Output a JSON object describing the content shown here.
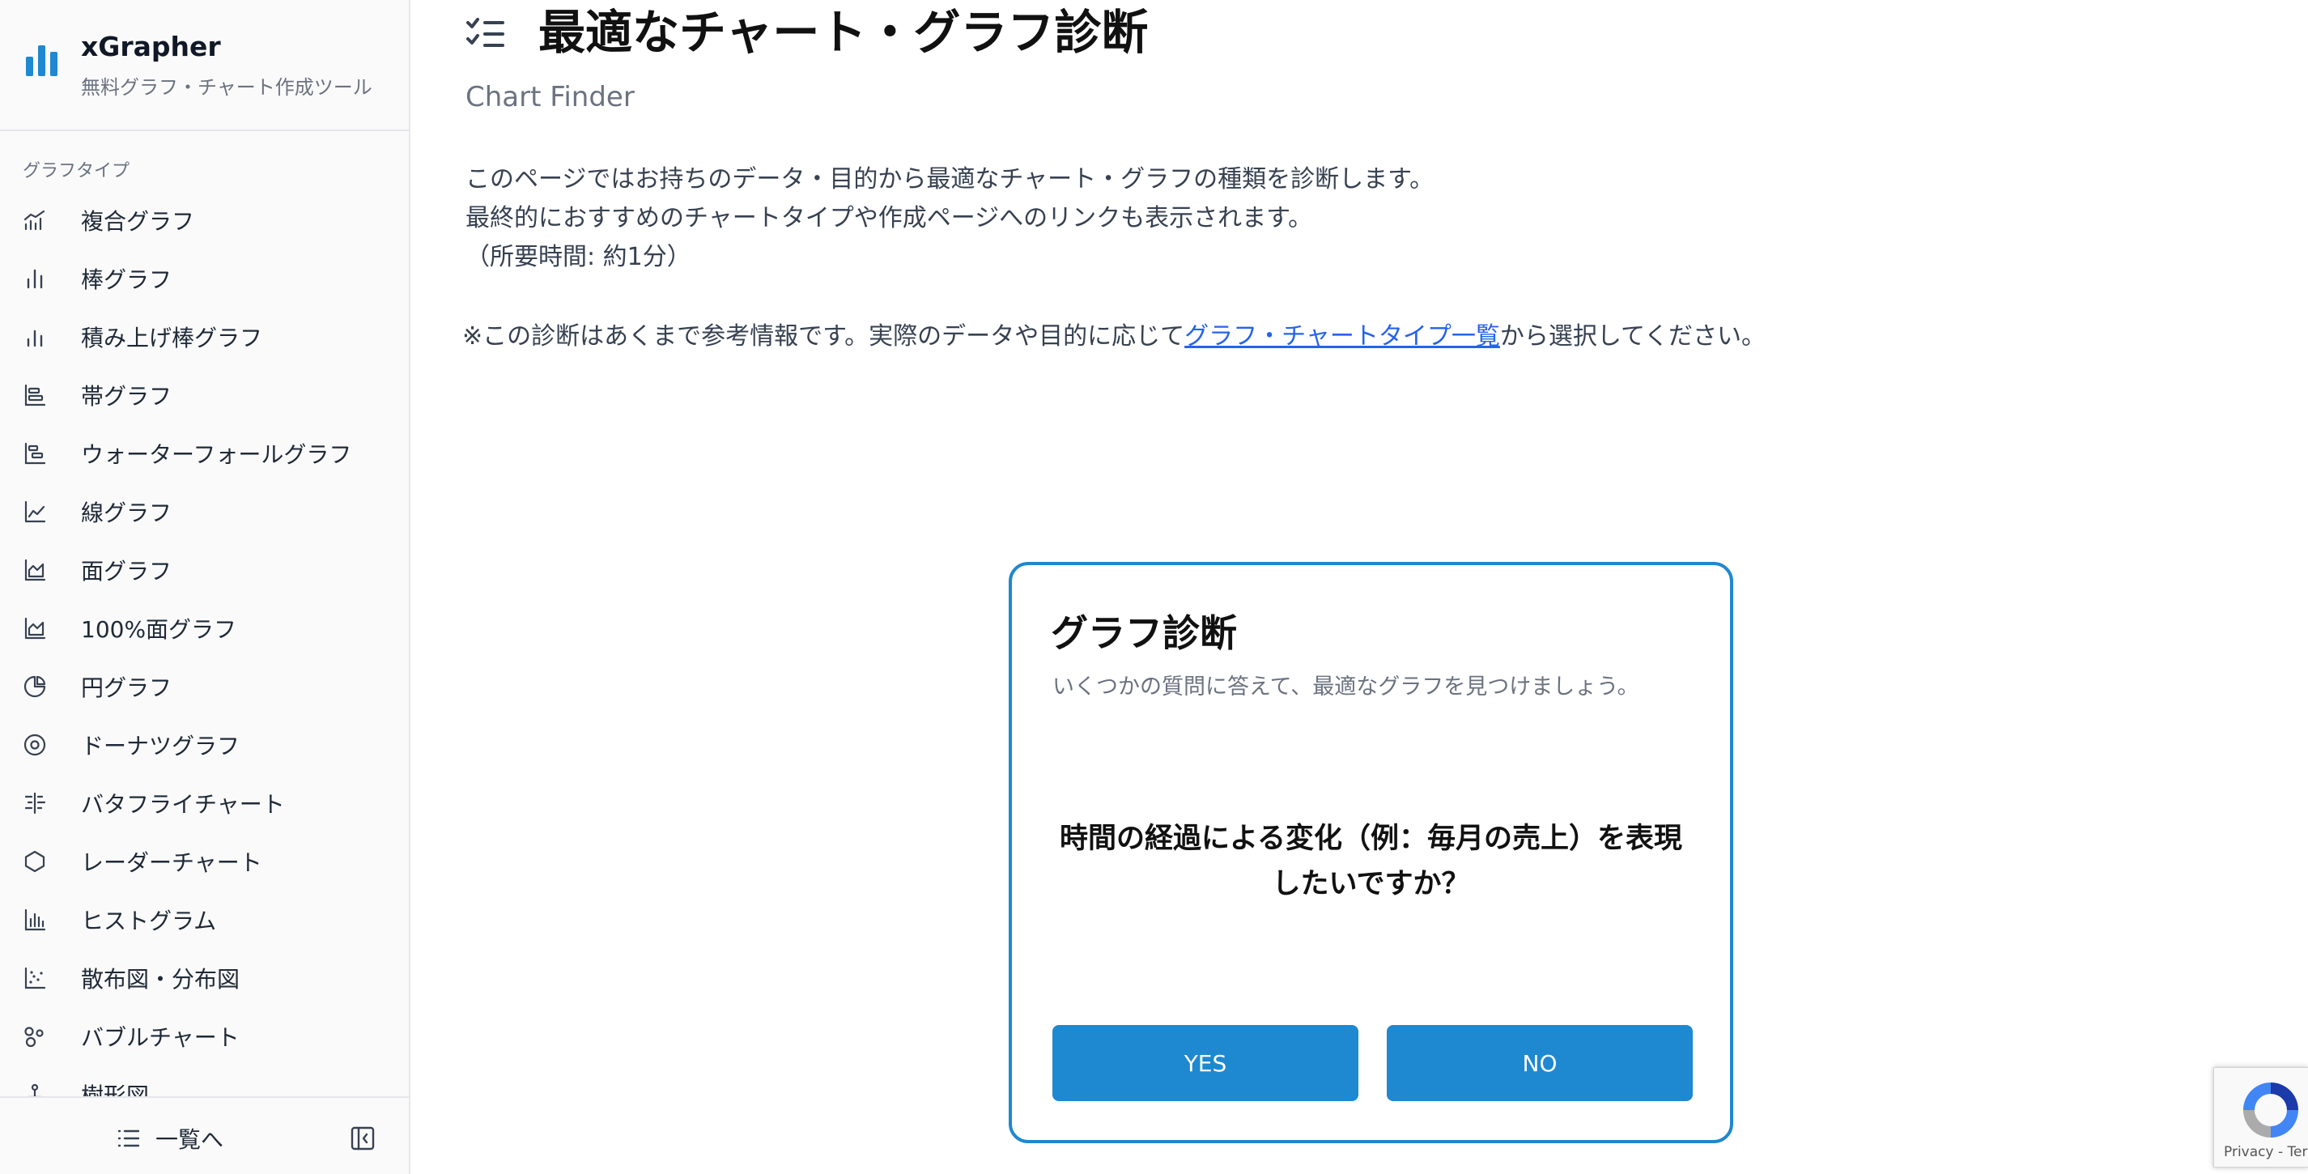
{
  "brand": {
    "title": "xGrapher",
    "subtitle": "無料グラフ・チャート作成ツール",
    "icon": "bar-chart-logo-icon",
    "color": "#1e88d0"
  },
  "sidebar": {
    "heading": "グラフタイプ",
    "items": [
      {
        "label": "複合グラフ",
        "icon": "combo-chart-icon"
      },
      {
        "label": "棒グラフ",
        "icon": "bar-chart-icon"
      },
      {
        "label": "積み上げ棒グラフ",
        "icon": "stacked-bar-chart-icon"
      },
      {
        "label": "帯グラフ",
        "icon": "horizontal-bar-chart-icon"
      },
      {
        "label": "ウォーターフォールグラフ",
        "icon": "waterfall-chart-icon"
      },
      {
        "label": "線グラフ",
        "icon": "line-chart-icon"
      },
      {
        "label": "面グラフ",
        "icon": "area-chart-icon"
      },
      {
        "label": "100%面グラフ",
        "icon": "percent-area-chart-icon"
      },
      {
        "label": "円グラフ",
        "icon": "pie-chart-icon"
      },
      {
        "label": "ドーナツグラフ",
        "icon": "donut-chart-icon"
      },
      {
        "label": "バタフライチャート",
        "icon": "butterfly-chart-icon"
      },
      {
        "label": "レーダーチャート",
        "icon": "radar-chart-icon"
      },
      {
        "label": "ヒストグラム",
        "icon": "histogram-icon"
      },
      {
        "label": "散布図・分布図",
        "icon": "scatter-chart-icon"
      },
      {
        "label": "バブルチャート",
        "icon": "bubble-chart-icon"
      },
      {
        "label": "樹形図",
        "icon": "tree-diagram-icon"
      }
    ],
    "footer": {
      "list_label": "一覧へ",
      "list_icon": "list-icon",
      "collapse_icon": "collapse-sidebar-icon"
    }
  },
  "main": {
    "title": "最適なチャート・グラフ診断",
    "title_icon": "checklist-icon",
    "subtitle": "Chart Finder",
    "intro_lines": [
      "このページではお持ちのデータ・目的から最適なチャート・グラフの種類を診断します。",
      "最終的におすすめのチャートタイプや作成ページへのリンクも表示されます。",
      "（所要時間: 約1分）"
    ],
    "note_prefix": "※この診断はあくまで参考情報です。実際のデータや目的に応じて",
    "note_link": "グラフ・チャートタイプ一覧",
    "note_suffix": "から選択してください。"
  },
  "card": {
    "title": "グラフ診断",
    "subtitle": "いくつかの質問に答えて、最適なグラフを見つけましょう。",
    "question_line1": "時間の経過による変化（例：毎月の売上）を表現",
    "question_line2": "したいですか？",
    "yes_label": "YES",
    "no_label": "NO",
    "accent_color": "#1e88d0"
  },
  "recaptcha": {
    "text": "Privacy - Terms"
  }
}
